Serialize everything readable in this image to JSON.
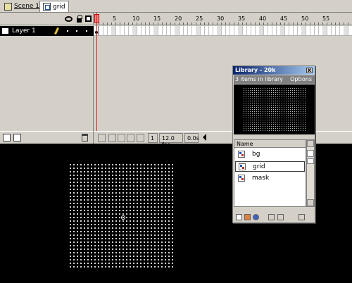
{
  "tabs": [
    {
      "label": "Scene 1",
      "active": false
    },
    {
      "label": "grid",
      "active": true
    }
  ],
  "timeline": {
    "layer_name": "Layer 1",
    "ruler_numbers": [
      "1",
      "5",
      "10",
      "15",
      "20",
      "25",
      "30",
      "35",
      "40",
      "45",
      "50",
      "55"
    ],
    "current_frame": "1",
    "frame_rate": "12.0 fps",
    "elapsed_time": "0.0s",
    "icons": [
      "eye-icon",
      "lock-icon",
      "outline-icon",
      "pencil-icon",
      "trash-icon"
    ]
  },
  "library": {
    "title": "Library - 20k",
    "subtitle": "3 items in library",
    "options_label": "Options",
    "close_label": "x",
    "column_name": "Name",
    "items": [
      {
        "name": "bg",
        "selected": false
      },
      {
        "name": "grid",
        "selected": true
      },
      {
        "name": "mask",
        "selected": false
      }
    ]
  },
  "colors": {
    "panel": "#d4d0c8",
    "stage": "#000000",
    "title_bar": "#0a246a",
    "playhead": "#d02020"
  }
}
